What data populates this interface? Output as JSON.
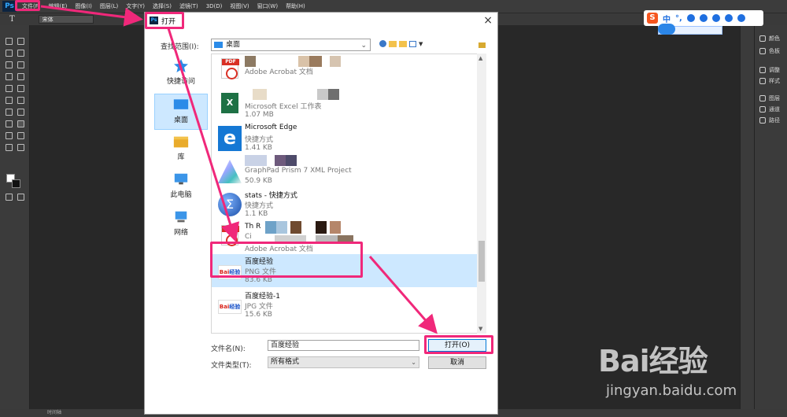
{
  "app": {
    "logo": "Ps",
    "menus": [
      "文件(F)",
      "编辑(E)",
      "图像(I)",
      "图层(L)",
      "文字(Y)",
      "选择(S)",
      "滤镜(T)",
      "3D(D)",
      "视图(V)",
      "窗口(W)",
      "帮助(H)"
    ],
    "options": {
      "tool_glyph": "T",
      "font": "宋体"
    },
    "status_text": "时间轴",
    "right_panel": [
      "颜色",
      "色板",
      "调整",
      "样式",
      "图层",
      "通道",
      "路径"
    ]
  },
  "ime": {
    "logo": "S",
    "lang": "中",
    "punct": "°,"
  },
  "dialog": {
    "title": "打开",
    "close": "×",
    "look_in_label": "查找范围(I):",
    "look_in_value": "桌面",
    "places": [
      {
        "label": "快捷访问",
        "icon": "star-icon",
        "selected": false
      },
      {
        "label": "桌面",
        "icon": "desktop-icon",
        "selected": true
      },
      {
        "label": "库",
        "icon": "library-icon",
        "selected": false
      },
      {
        "label": "此电脑",
        "icon": "computer-icon",
        "selected": false
      },
      {
        "label": "网络",
        "icon": "network-icon",
        "selected": false
      }
    ],
    "files": [
      {
        "name": "",
        "type": "Adobe Acrobat 文档",
        "size": "",
        "icon": "pdf"
      },
      {
        "name": "",
        "type": "Microsoft Excel 工作表",
        "size": "1.07 MB",
        "icon": "excel"
      },
      {
        "name": "Microsoft Edge",
        "type": "快捷方式",
        "size": "1.41 KB",
        "icon": "edge"
      },
      {
        "name": "",
        "type": "GraphPad Prism 7 XML Project",
        "size": "50.9 KB",
        "icon": "prism"
      },
      {
        "name": "stats - 快捷方式",
        "type": "快捷方式",
        "size": "1.1 KB",
        "icon": "stats"
      },
      {
        "name": "Th R",
        "type": "Ci",
        "size": "Adobe Acrobat 文档",
        "icon": "pdf"
      },
      {
        "name": "百度经验",
        "type": "PNG 文件",
        "size": "83.6 KB",
        "icon": "image",
        "selected": true
      },
      {
        "name": "百度经验-1",
        "type": "JPG 文件",
        "size": "15.6 KB",
        "icon": "image"
      }
    ],
    "file_name_label": "文件名(N):",
    "file_name_value": "百度经验",
    "file_type_label": "文件类型(T):",
    "file_type_value": "所有格式",
    "open_button": "打开(O)",
    "cancel_button": "取消"
  },
  "watermark": {
    "brand": "Bai经验",
    "url": "jingyan.baidu.com"
  },
  "colors": {
    "highlight": "#f0287a",
    "selection": "#cde8ff",
    "ps_blue": "#31a8ff"
  }
}
